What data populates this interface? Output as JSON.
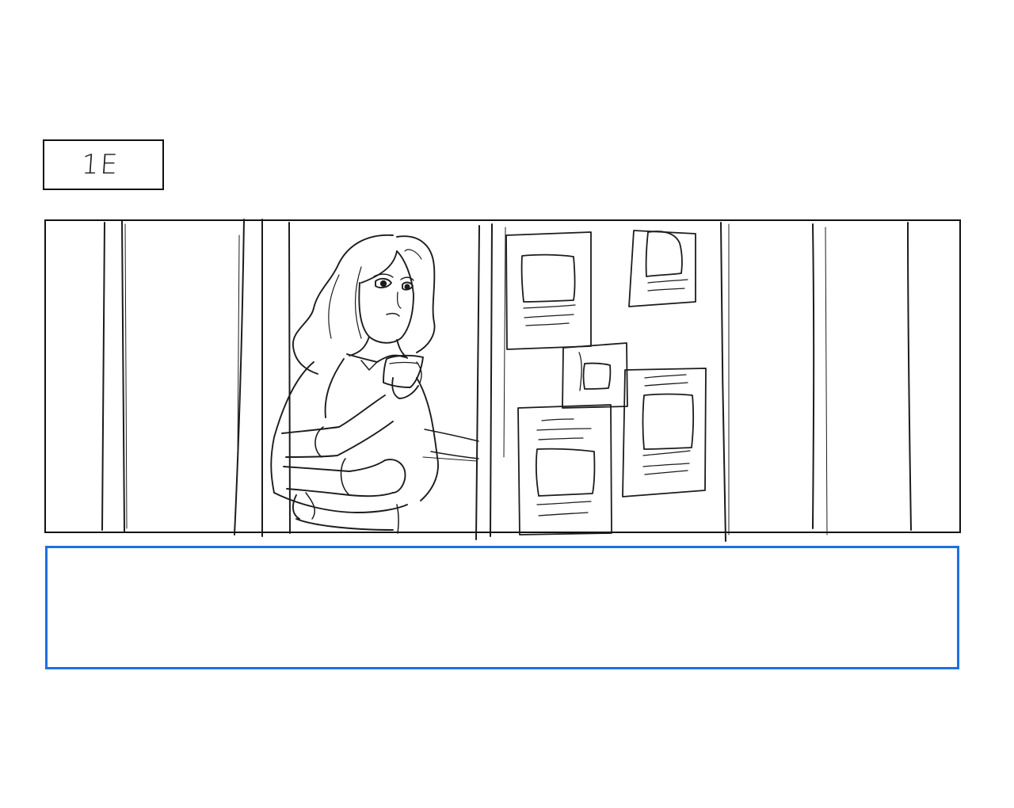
{
  "shot": {
    "label": "1E"
  },
  "panel": {
    "image": "storyboard-sketch-woman-with-phone"
  },
  "notes": {
    "text": "",
    "border_color": "#1f6fe0"
  }
}
